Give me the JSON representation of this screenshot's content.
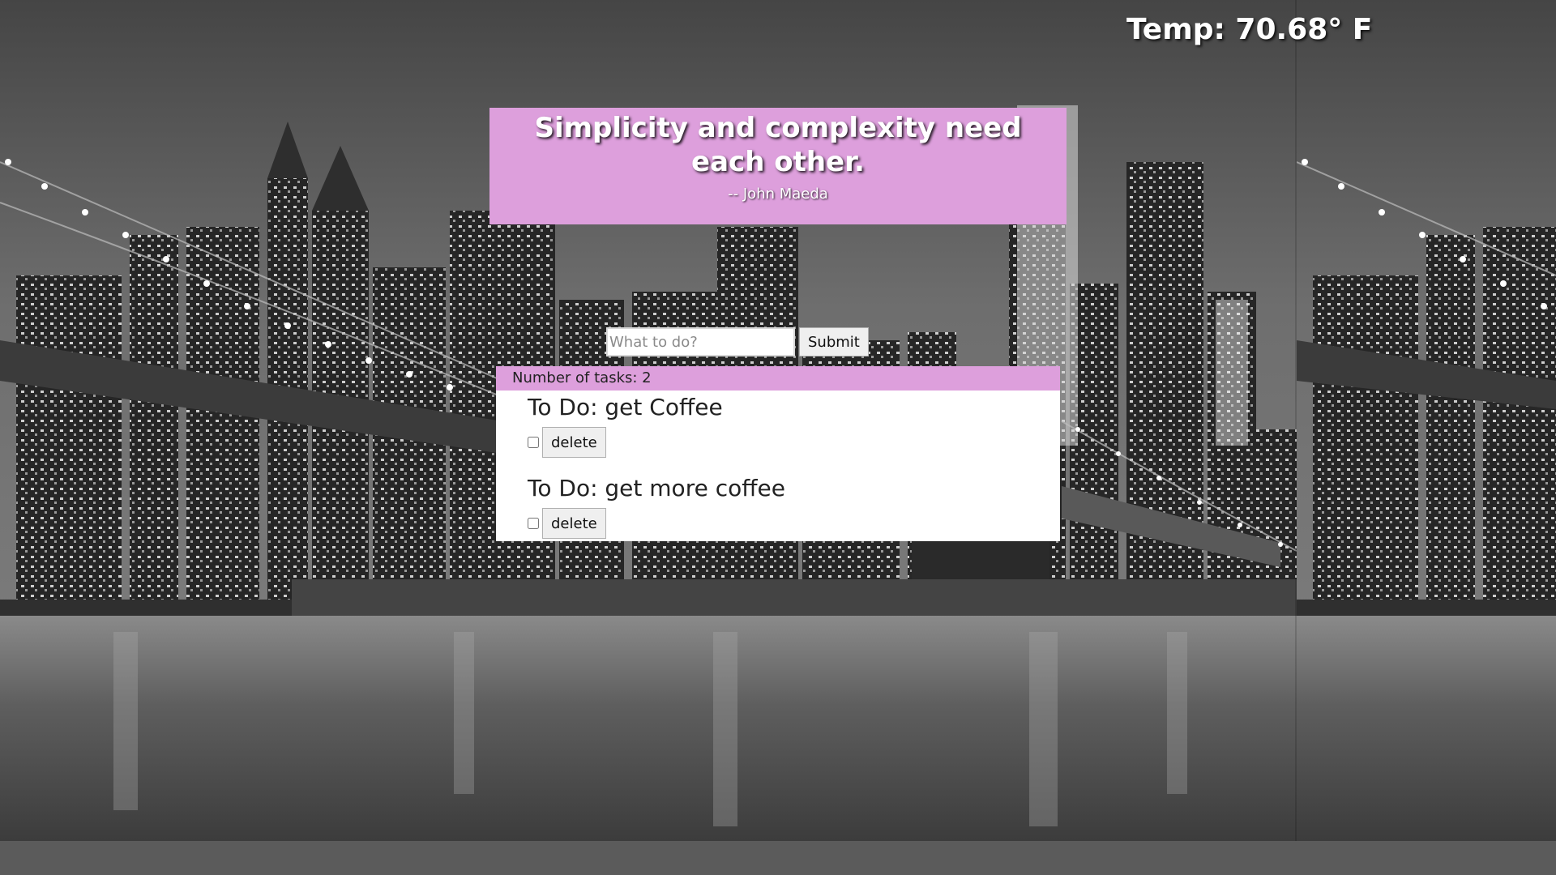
{
  "header": {
    "temperature": "Temp: 70.68° F"
  },
  "quote": {
    "text": "Simplicity and complexity need each other.",
    "author": "-- John Maeda"
  },
  "form": {
    "input_placeholder": "What to do?",
    "input_value": "",
    "submit_label": "Submit"
  },
  "tasks": {
    "count_label": "Number of tasks: 2",
    "items": [
      {
        "title": "To Do: get Coffee",
        "checked": false,
        "delete_label": "delete"
      },
      {
        "title": "To Do: get more coffee",
        "checked": false,
        "delete_label": "delete"
      }
    ]
  },
  "colors": {
    "accent": "#dd9fdc",
    "panel": "#ffffff",
    "background_tone": "#5a5a5a"
  },
  "background": {
    "description_icon": "city-skyline-photo"
  }
}
